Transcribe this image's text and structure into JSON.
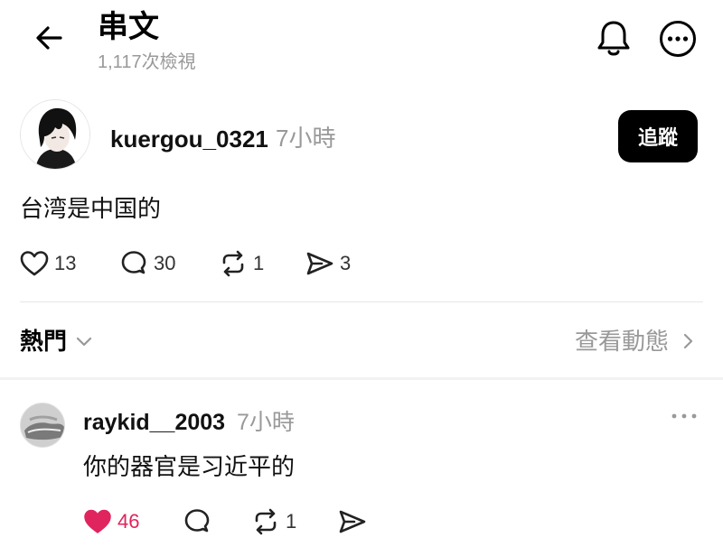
{
  "header": {
    "title": "串文",
    "views": "1,117次檢視"
  },
  "post": {
    "author": "kuergou_0321",
    "time": "7小時",
    "follow_label": "追蹤",
    "text": "台湾是中国的",
    "likes": "13",
    "replies": "30",
    "reposts": "1",
    "shares": "3"
  },
  "sort": {
    "label": "熱門",
    "activity_label": "查看動態"
  },
  "comment": {
    "author": "raykid__2003",
    "time": "7小時",
    "text": "你的器官是习近平的",
    "likes": "46",
    "liked": true,
    "reposts": "1"
  },
  "colors": {
    "like_active": "#e0245e",
    "muted": "#999999",
    "follow_bg": "#000000"
  },
  "icons": [
    "back-arrow-icon",
    "bell-icon",
    "more-circle-icon",
    "heart-icon",
    "comment-icon",
    "repost-icon",
    "share-icon",
    "chevron-down-icon",
    "chevron-right-icon",
    "more-dots-icon"
  ]
}
